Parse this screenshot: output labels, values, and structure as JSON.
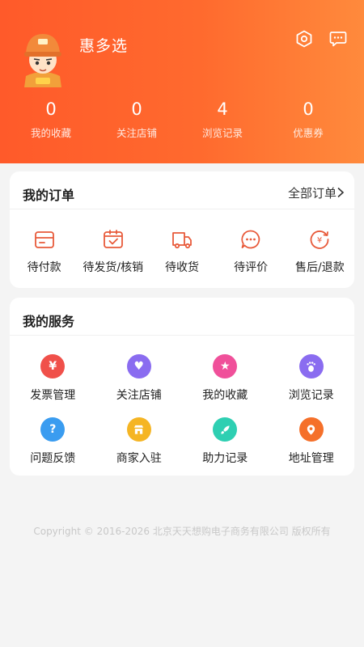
{
  "profile": {
    "username": "惠多选",
    "avatar": "firefighter-avatar"
  },
  "header_icons": {
    "settings": "settings-hexagon-icon",
    "messages": "message-bubble-icon"
  },
  "stats": [
    {
      "value": "0",
      "label": "我的收藏"
    },
    {
      "value": "0",
      "label": "关注店铺"
    },
    {
      "value": "4",
      "label": "浏览记录"
    },
    {
      "value": "0",
      "label": "优惠券"
    }
  ],
  "orders": {
    "title": "我的订单",
    "all_label": "全部订单",
    "items": [
      {
        "label": "待付款",
        "icon": "wallet-icon"
      },
      {
        "label": "待发货/核销",
        "icon": "box-check-icon"
      },
      {
        "label": "待收货",
        "icon": "truck-icon"
      },
      {
        "label": "待评价",
        "icon": "comment-icon"
      },
      {
        "label": "售后/退款",
        "icon": "refund-icon"
      }
    ]
  },
  "services": {
    "title": "我的服务",
    "items": [
      {
        "label": "发票管理",
        "icon": "invoice-icon",
        "color": "#f0504a"
      },
      {
        "label": "关注店铺",
        "icon": "heart-icon",
        "color": "#8a6cf0"
      },
      {
        "label": "我的收藏",
        "icon": "star-icon",
        "color": "#f0509a"
      },
      {
        "label": "浏览记录",
        "icon": "footprint-icon",
        "color": "#8a6cf0"
      },
      {
        "label": "问题反馈",
        "icon": "question-icon",
        "color": "#3a9cf0"
      },
      {
        "label": "商家入驻",
        "icon": "store-icon",
        "color": "#f5b524"
      },
      {
        "label": "助力记录",
        "icon": "rocket-icon",
        "color": "#2ecfb2"
      },
      {
        "label": "地址管理",
        "icon": "location-icon",
        "color": "#f5702a"
      }
    ]
  },
  "footer": {
    "copyright": "Copyright © 2016-2026 北京天天想购电子商务有限公司 版权所有"
  },
  "colors": {
    "brand": "#ff6a2e",
    "order_icon": "#e85a3a"
  }
}
